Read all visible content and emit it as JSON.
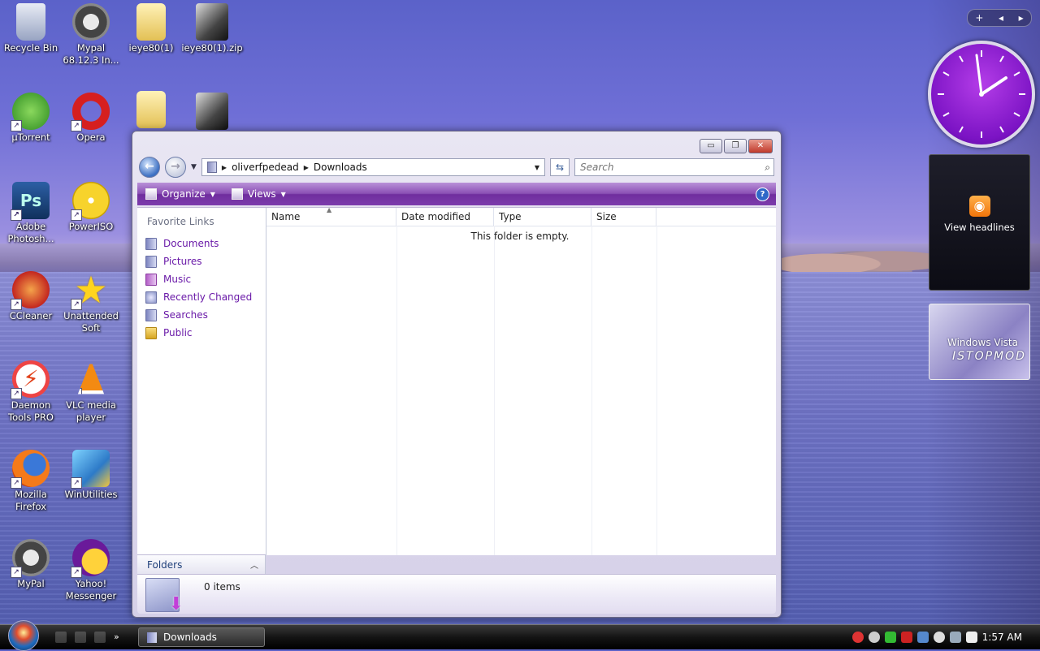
{
  "desktop": {
    "icons": [
      {
        "label": "Recycle Bin"
      },
      {
        "label": "Mypal 68.12.3 In..."
      },
      {
        "label": "ieye80(1)"
      },
      {
        "label": "ieye80(1).zip"
      },
      {
        "label": "µTorrent"
      },
      {
        "label": "Opera"
      },
      {
        "label": "Adobe Photosh..."
      },
      {
        "label": "PowerISO"
      },
      {
        "label": "CCleaner"
      },
      {
        "label": "Unattended Soft"
      },
      {
        "label": "Daemon Tools PRO"
      },
      {
        "label": "VLC media player"
      },
      {
        "label": "Mozilla Firefox"
      },
      {
        "label": "WinUtilities"
      },
      {
        "label": "MyPal"
      },
      {
        "label": "Yahoo! Messenger"
      }
    ]
  },
  "window": {
    "caption": {
      "minimize": "▭",
      "maximize": "❐",
      "close": "✕"
    },
    "address": {
      "segment1": "oliverfpedead",
      "segment2": "Downloads"
    },
    "search": {
      "placeholder": "Search"
    },
    "toolbar": {
      "organize": "Organize",
      "views": "Views",
      "help": "?"
    },
    "nav_pane": {
      "heading": "Favorite Links",
      "links": [
        {
          "label": "Documents"
        },
        {
          "label": "Pictures"
        },
        {
          "label": "Music"
        },
        {
          "label": "Recently Changed"
        },
        {
          "label": "Searches"
        },
        {
          "label": "Public"
        }
      ],
      "folders_label": "Folders"
    },
    "columns": {
      "name": "Name",
      "date": "Date modified",
      "type": "Type",
      "size": "Size"
    },
    "empty_message": "This folder is empty.",
    "details": {
      "count": "0 items"
    }
  },
  "gadgets": {
    "headlines_label": "View headlines",
    "slideshow_text1": "Windows Vista",
    "slideshow_text2": "ISTOPMOD"
  },
  "taskbar": {
    "task_label": "Downloads",
    "clock": "1:57 AM"
  }
}
